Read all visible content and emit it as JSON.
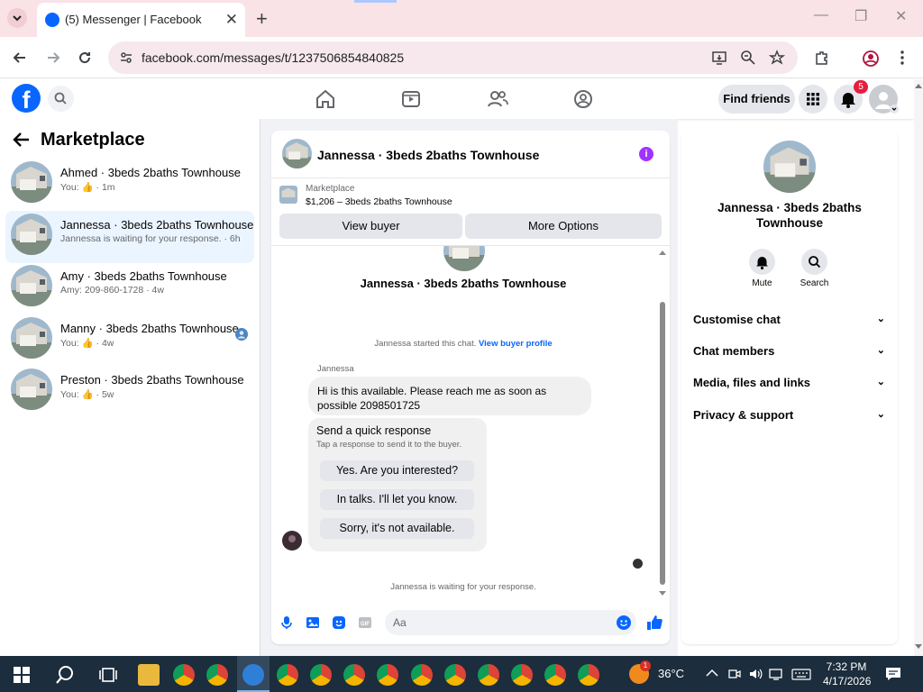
{
  "browser": {
    "tab_title": "(5) Messenger | Facebook",
    "url": "facebook.com/messages/t/1237506854840825"
  },
  "header": {
    "find_friends": "Find friends",
    "notification_count": "5"
  },
  "left": {
    "title": "Marketplace",
    "chats": [
      {
        "name": "Ahmed · 3beds 2baths Townhouse",
        "preview": "You: 👍 · 1m"
      },
      {
        "name": "Jannessa · 3beds 2baths Townhouse",
        "preview": "Jannessa is waiting for your response. · 6h"
      },
      {
        "name": "Amy · 3beds 2baths Townhouse",
        "preview": "Amy: 209-860-1728 · 4w"
      },
      {
        "name": "Manny · 3beds 2baths Townhouse",
        "preview": "You: 👍 · 4w"
      },
      {
        "name": "Preston · 3beds 2baths Townhouse",
        "preview": "You: 👍 · 5w"
      }
    ]
  },
  "conversation": {
    "title": "Jannessa · 3beds 2baths Townhouse",
    "listing_label": "Marketplace",
    "listing_price": "$1,206 – 3beds 2baths Townhouse",
    "view_buyer": "View buyer",
    "more_options": "More Options",
    "intro_name": "Jannessa · 3beds 2baths Townhouse",
    "started_text": "Jannessa started this chat.",
    "view_buyer_profile": "View buyer profile",
    "sender": "Jannessa",
    "message": "Hi is this available. Please reach me as soon as possible 2098501725",
    "quick_title": "Send a quick response",
    "quick_sub": "Tap a response to send it to the buyer.",
    "quick_options": [
      "Yes. Are you interested?",
      "In talks. I'll let you know.",
      "Sorry, it's not available."
    ],
    "waiting": "Jannessa is waiting for your response.",
    "composer_placeholder": "Aa"
  },
  "details": {
    "name": "Jannessa · 3beds 2baths Townhouse",
    "mute": "Mute",
    "search": "Search",
    "sections": [
      "Customise chat",
      "Chat members",
      "Media, files and links",
      "Privacy & support"
    ]
  },
  "taskbar": {
    "temperature": "36°C",
    "time": "7:32 PM",
    "date": "4/17/2026",
    "weather_badge": "1"
  },
  "colors": {
    "accent": "#0866ff",
    "tabbar": "#f9e3e7",
    "taskbar": "#1c2d3d",
    "info": "#a033ff"
  }
}
